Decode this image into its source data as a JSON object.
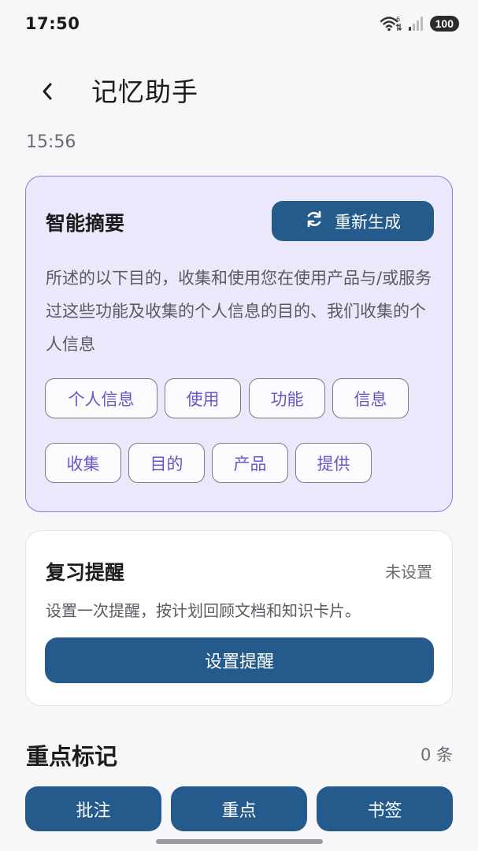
{
  "status_bar": {
    "time": "17:50",
    "battery": "100",
    "icons": [
      "wifi-6-icon",
      "signal-icon",
      "battery-icon"
    ]
  },
  "header": {
    "back_icon": "chevron-left-icon",
    "title": "记忆助手"
  },
  "timestamp": "15:56",
  "summary": {
    "title": "智能摘要",
    "regenerate_label": "重新生成",
    "regenerate_icon": "refresh-icon",
    "text": "所述的以下目的，收集和使用您在使用产品与/或服务过这些功能及收集的个人信息的目的、我们收集的个人信息",
    "tags": [
      "个人信息",
      "使用",
      "功能",
      "信息",
      "收集",
      "目的",
      "产品",
      "提供"
    ]
  },
  "reminder": {
    "title": "复习提醒",
    "status": "未设置",
    "description": "设置一次提醒，按计划回顾文档和知识卡片。",
    "button_label": "设置提醒"
  },
  "marks": {
    "title": "重点标记",
    "count": "0 条",
    "buttons": [
      "批注",
      "重点",
      "书签"
    ]
  },
  "colors": {
    "accent": "#245a8c",
    "summary_bg": "#ebe8fc",
    "summary_border": "#8a78df",
    "tag_text": "#6a55c7"
  }
}
